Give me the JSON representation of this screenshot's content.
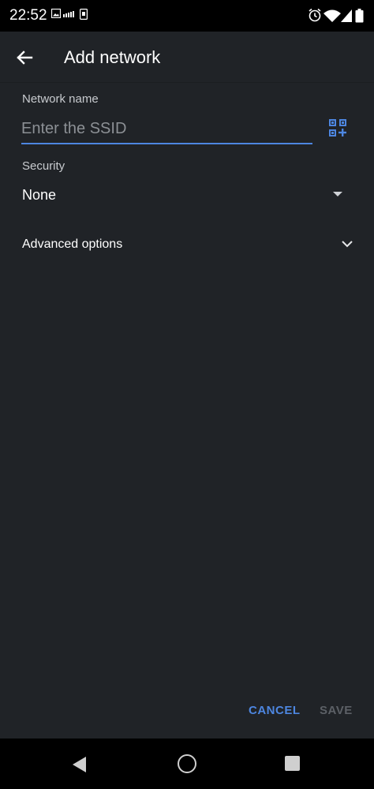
{
  "status_bar": {
    "time": "22:52",
    "icons": [
      "image-icon",
      "signal-meter-icon",
      "sim-icon",
      "alarm-icon",
      "wifi-icon",
      "cell-signal-icon",
      "battery-icon"
    ]
  },
  "app_bar": {
    "title": "Add network",
    "back_icon": "arrow-back-icon"
  },
  "form": {
    "network_name_label": "Network name",
    "ssid_value": "",
    "ssid_placeholder": "Enter the SSID",
    "qr_icon": "qr-code-add-icon",
    "security_label": "Security",
    "security_value": "None",
    "advanced_label": "Advanced options"
  },
  "actions": {
    "cancel_label": "CANCEL",
    "save_label": "SAVE"
  },
  "colors": {
    "background": "#202327",
    "accent": "#4d86e0",
    "disabled": "#5c6066"
  },
  "nav_bar": {
    "icons": [
      "nav-back-icon",
      "nav-home-icon",
      "nav-recents-icon"
    ]
  }
}
